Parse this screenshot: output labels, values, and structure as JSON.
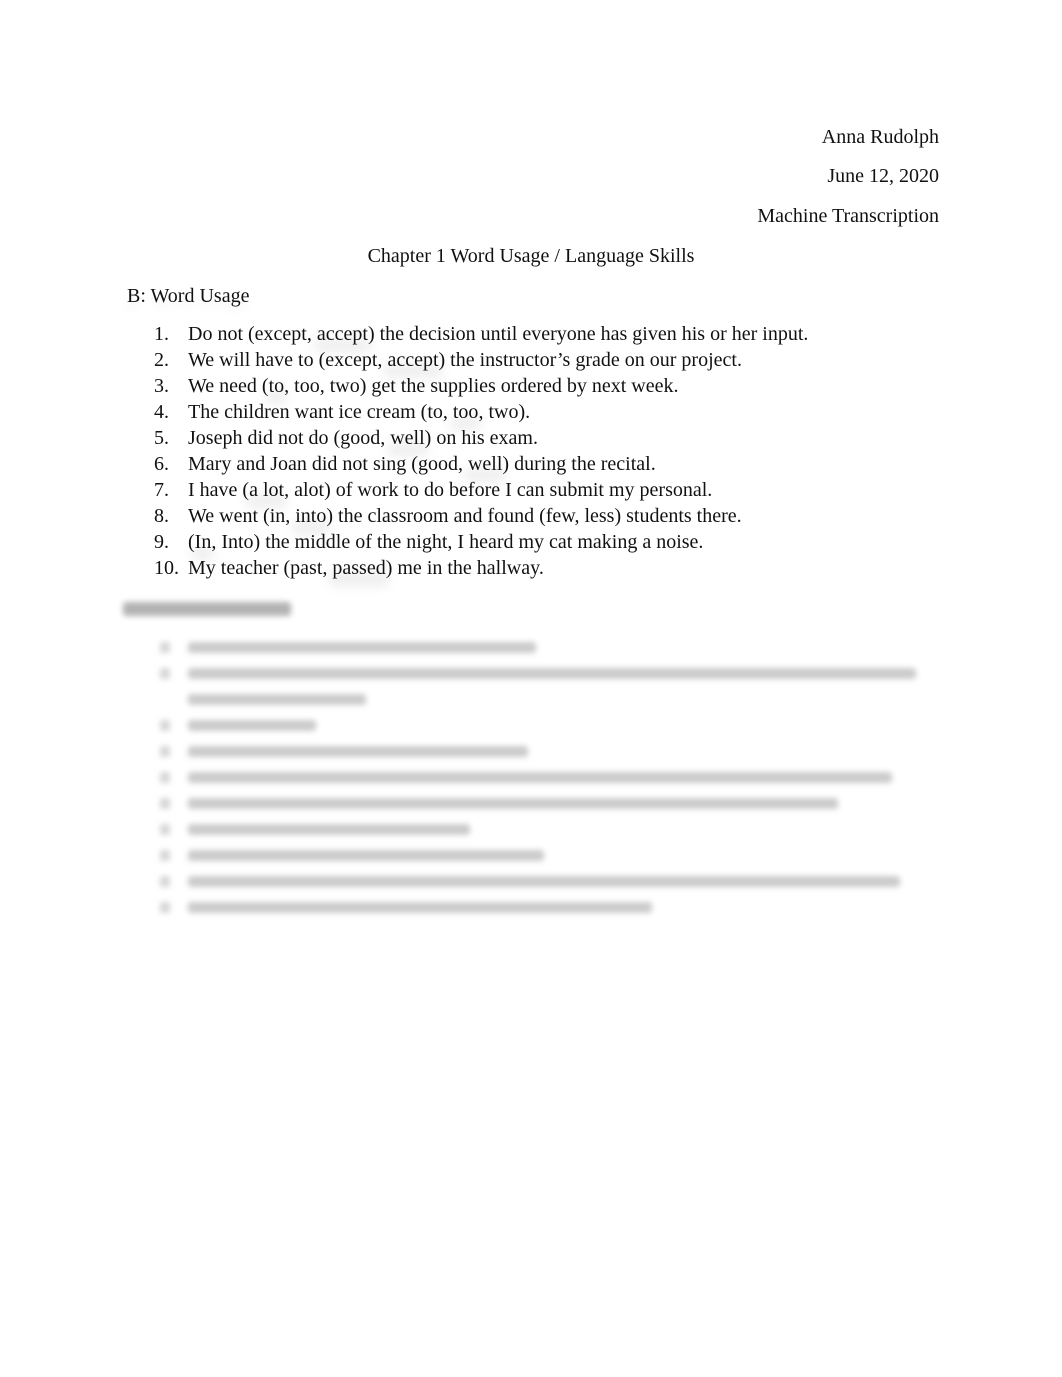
{
  "header": {
    "author": "Anna Rudolph",
    "date": "June 12, 2020",
    "course": "Machine Transcription"
  },
  "title": "Chapter 1 Word Usage / Language Skills",
  "section_b": {
    "heading": "B: Word Usage",
    "items": [
      {
        "number": "1.",
        "before": "Do not (except, ",
        "answer": "accept",
        "after": ") the decision until everyone has given his or her input."
      },
      {
        "number": "2.",
        "before": "We will have to (except, ",
        "answer": "accept",
        "after": ") the instructor’s grade on our project."
      },
      {
        "number": "3.",
        "before": "We need (",
        "answer": "to",
        "after": ", too, two) get the supplies ordered by next week."
      },
      {
        "number": "4.",
        "before": "The children want ice cream (to, ",
        "answer": "too",
        "after": ", two)."
      },
      {
        "number": "5.",
        "before": "Joseph did not do (good, ",
        "answer": "well",
        "after": ") on his exam."
      },
      {
        "number": "6.",
        "before": "Mary and Joan did not sing (good, ",
        "answer": "well",
        "after": ") during the recital."
      },
      {
        "number": "7.",
        "before": "I have (",
        "answer": "a lot",
        "after": ", alot) of work to do before I can submit my personal."
      },
      {
        "number": "8.",
        "before": "We went (in, ",
        "answer": "into",
        "after": ") the classroom and found (few, less) students there."
      },
      {
        "number": "9.",
        "before": "(",
        "answer": "In",
        "after": ", Into) the middle of the night, I heard my cat making a noise."
      },
      {
        "number": "10.",
        "before": "My teacher (past, ",
        "answer": "passed",
        "after": ") me in the hallway."
      }
    ]
  },
  "section_c": {
    "blurred": true,
    "line_count": 11
  }
}
